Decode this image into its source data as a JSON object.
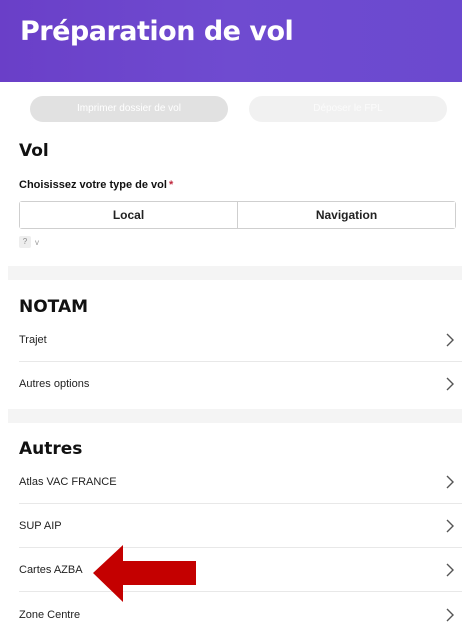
{
  "header": {
    "title": "Préparation de vol"
  },
  "actions": {
    "print_label": "Imprimer dossier de vol",
    "fpl_label": "Déposer le FPL"
  },
  "vol": {
    "section_title": "Vol",
    "flight_type_label": "Choisissez votre type de vol",
    "required_marker": "*",
    "options": [
      "Local",
      "Navigation"
    ],
    "help_label": "?",
    "help_chevron": "v"
  },
  "notam": {
    "section_title": "NOTAM",
    "items": [
      "Trajet",
      "Autres options"
    ]
  },
  "autres": {
    "section_title": "Autres",
    "items": [
      "Atlas VAC FRANCE",
      "SUP AIP",
      "Cartes AZBA",
      "Zone Centre"
    ]
  },
  "colors": {
    "header_gradient_start": "#6a3fc8",
    "header_gradient_end": "#6b49cf",
    "annotation_arrow": "#c40000",
    "required_star": "#c0283e"
  },
  "icons": {
    "row_chevron": "chevron-right-icon",
    "annotation": "arrow-left-icon"
  }
}
